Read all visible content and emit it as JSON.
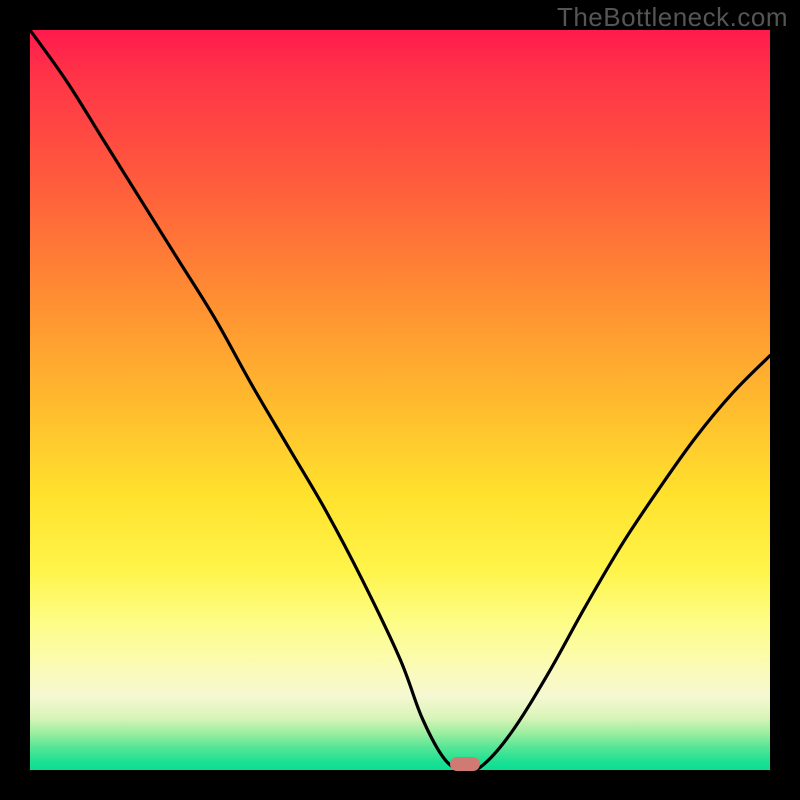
{
  "watermark": "TheBottleneck.com",
  "colors": {
    "frame": "#000000",
    "gradient_top": "#ff1a4d",
    "gradient_mid": "#ffe22d",
    "gradient_bottom": "#0bdf93",
    "curve": "#000000",
    "marker": "#d07a74",
    "watermark": "#555555"
  },
  "chart_data": {
    "type": "line",
    "title": "",
    "xlabel": "",
    "ylabel": "",
    "xlim": [
      0,
      100
    ],
    "ylim": [
      0,
      100
    ],
    "x": [
      0,
      5,
      10,
      15,
      20,
      25,
      30,
      35,
      40,
      45,
      50,
      53,
      56,
      58.5,
      61,
      65,
      70,
      75,
      80,
      85,
      90,
      95,
      100
    ],
    "values": [
      100,
      93,
      85,
      77,
      69,
      61,
      52,
      43.5,
      35,
      25.5,
      15,
      7,
      1.5,
      0,
      0.5,
      5,
      13,
      22,
      30.5,
      38,
      45,
      51,
      56
    ],
    "valley_x": 58.5,
    "valley_y": 0,
    "marker": {
      "x": 58.8,
      "y": 0.8
    }
  }
}
